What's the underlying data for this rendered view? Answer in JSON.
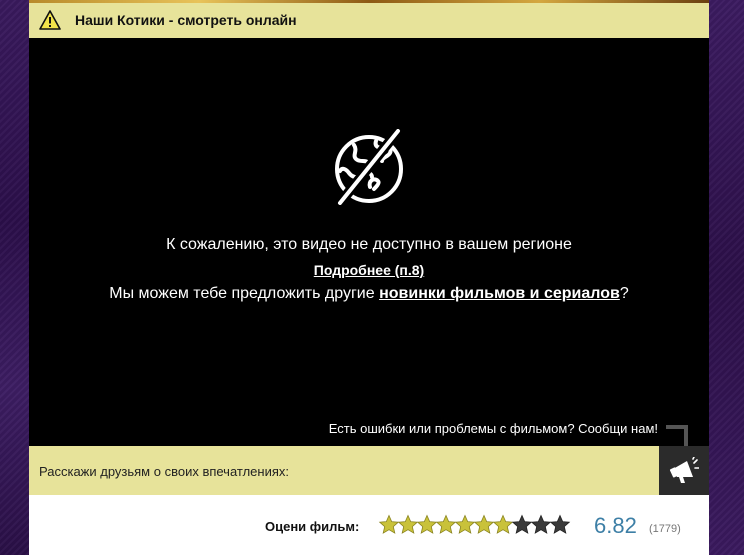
{
  "header": {
    "title": "Наши Котики - смотреть онлайн",
    "warning_icon": "warning-triangle-icon"
  },
  "player": {
    "blocked_icon": "globe-blocked-icon",
    "message_line1": "К сожалению, это видео не доступно в вашем регионе",
    "more_link": "Подробнее (п.8)",
    "message_line3_prefix": "Мы можем тебе предложить другие ",
    "message_line3_link": "новинки фильмов и сериалов",
    "message_line3_suffix": "?",
    "report_text": "Есть ошибки или проблемы с фильмом? Сообщи нам!"
  },
  "share": {
    "text": "Расскажи друзьям о своих впечатлениях:",
    "button_icon": "megaphone-icon"
  },
  "rating": {
    "label": "Оцени фильм:",
    "value": "6.82",
    "count": "(1779)",
    "max_stars": 10,
    "filled_stars": 7,
    "colors": {
      "filled": "#c9c23a",
      "empty": "#3a3a3a",
      "value_text": "#3d7fa6"
    }
  },
  "colors": {
    "accent_yellow": "#e7e39a",
    "player_bg": "#000000",
    "page_bg": "#2a1245"
  }
}
